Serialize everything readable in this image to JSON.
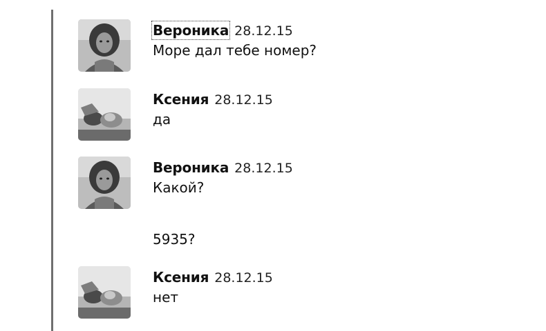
{
  "messages": [
    {
      "author": "Вероника",
      "date": "28.12.15",
      "text": "Море дал тебе номер?",
      "avatar_icon": "avatar-veronika"
    },
    {
      "author": "Ксения",
      "date": "28.12.15",
      "text": "да",
      "avatar_icon": "avatar-kseniya"
    },
    {
      "author": "Вероника",
      "date": "28.12.15",
      "text": "Какой?",
      "avatar_icon": "avatar-veronika"
    },
    {
      "author": "Ксения",
      "date": "28.12.15",
      "text": "нет",
      "avatar_icon": "avatar-kseniya"
    }
  ],
  "continuation": {
    "text": "5935?"
  }
}
